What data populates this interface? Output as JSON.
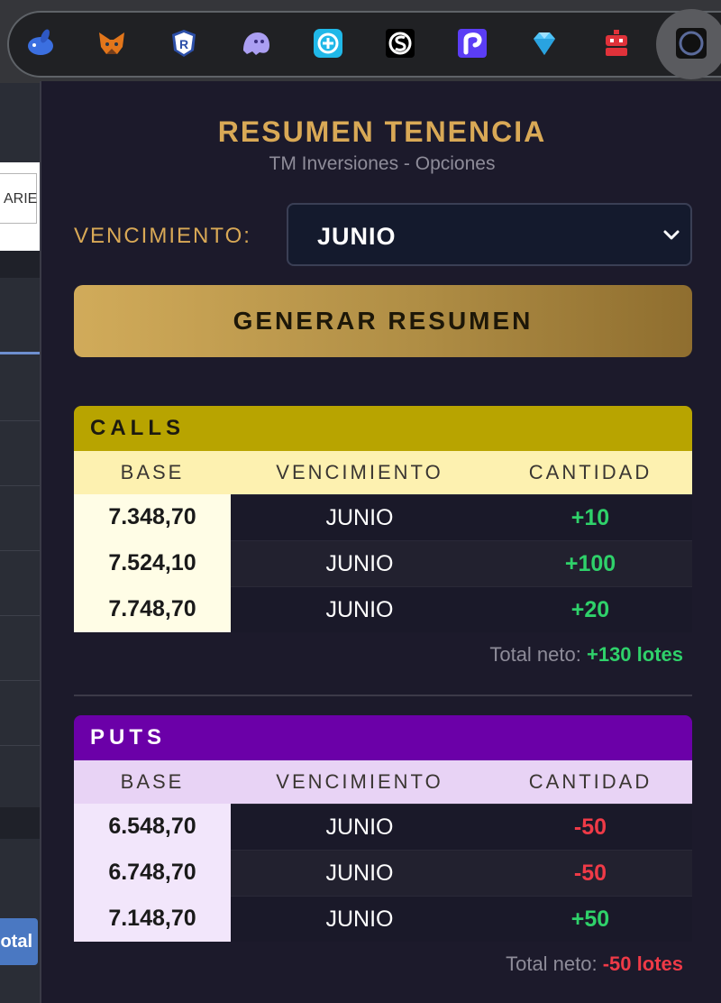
{
  "browser": {
    "extensions": [
      {
        "name": "blue-rabbit-icon"
      },
      {
        "name": "metamask-fox-icon"
      },
      {
        "name": "shield-r-icon"
      },
      {
        "name": "ghost-icon"
      },
      {
        "name": "compass-plus-icon"
      },
      {
        "name": "s-ring-icon"
      },
      {
        "name": "r-square-icon"
      },
      {
        "name": "diamond-icon"
      },
      {
        "name": "red-robot-icon"
      },
      {
        "name": "circle-extension-icon"
      }
    ]
  },
  "page": {
    "field_text": "ARIE",
    "total_button": "otal"
  },
  "popup": {
    "title": "RESUMEN TENENCIA",
    "subtitle": "TM Inversiones - Opciones",
    "vencimiento_label": "VENCIMIENTO:",
    "vencimiento_value": "JUNIO",
    "generate_button": "GENERAR RESUMEN",
    "colors": {
      "accent_gold": "#d9a956",
      "calls_header": "#b8a400",
      "puts_header": "#6b00a8",
      "positive": "#2fd16a",
      "negative": "#ef3a47"
    },
    "calls": {
      "title": "CALLS",
      "headers": [
        "BASE",
        "VENCIMIENTO",
        "CANTIDAD"
      ],
      "rows": [
        {
          "base": "7.348,70",
          "vencimiento": "JUNIO",
          "cantidad": "+10"
        },
        {
          "base": "7.524,10",
          "vencimiento": "JUNIO",
          "cantidad": "+100"
        },
        {
          "base": "7.748,70",
          "vencimiento": "JUNIO",
          "cantidad": "+20"
        }
      ],
      "total_label": "Total neto:",
      "total_value": "+130 lotes"
    },
    "puts": {
      "title": "PUTS",
      "headers": [
        "BASE",
        "VENCIMIENTO",
        "CANTIDAD"
      ],
      "rows": [
        {
          "base": "6.548,70",
          "vencimiento": "JUNIO",
          "cantidad": "-50"
        },
        {
          "base": "6.748,70",
          "vencimiento": "JUNIO",
          "cantidad": "-50"
        },
        {
          "base": "7.148,70",
          "vencimiento": "JUNIO",
          "cantidad": "+50"
        }
      ],
      "total_label": "Total neto:",
      "total_value": "-50 lotes"
    }
  }
}
